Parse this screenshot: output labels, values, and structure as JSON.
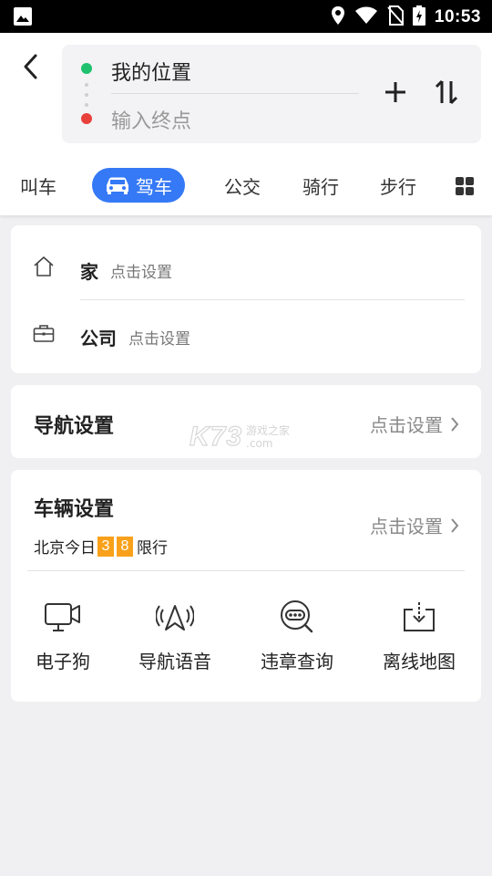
{
  "status_bar": {
    "time": "10:53",
    "icons": [
      "image-icon",
      "location-icon",
      "wifi-icon",
      "no-sim-icon",
      "battery-charging-icon"
    ]
  },
  "route": {
    "back_icon": "back-arrow-icon",
    "from": "我的位置",
    "to_placeholder": "输入终点",
    "add_icon": "plus-icon",
    "swap_icon": "swap-vertical-icon",
    "start_color": "#1fc16e",
    "end_color": "#e8403a"
  },
  "tabs": {
    "items": [
      {
        "label": "叫车"
      },
      {
        "label": "驾车",
        "active": true,
        "icon": "car-icon"
      },
      {
        "label": "公交"
      },
      {
        "label": "骑行"
      },
      {
        "label": "步行"
      }
    ],
    "more_icon": "grid-icon",
    "active_color": "#3579f6"
  },
  "places": {
    "home": {
      "name": "家",
      "hint": "点击设置",
      "icon": "home-icon"
    },
    "company": {
      "name": "公司",
      "hint": "点击设置",
      "icon": "briefcase-icon"
    }
  },
  "nav_settings": {
    "title": "导航设置",
    "action": "点击设置"
  },
  "watermark": {
    "logo": "K73",
    "line1": "游戏之家",
    "line2": ".com"
  },
  "vehicle_settings": {
    "title": "车辆设置",
    "action": "点击设置",
    "restriction": {
      "prefix": "北京今日",
      "plates": [
        "3",
        "8"
      ],
      "suffix": "限行"
    },
    "plate_color": "#f9a11b",
    "tools": [
      {
        "label": "电子狗",
        "icon": "camera-icon"
      },
      {
        "label": "导航语音",
        "icon": "nav-voice-icon"
      },
      {
        "label": "违章查询",
        "icon": "violation-search-icon"
      },
      {
        "label": "离线地图",
        "icon": "offline-download-icon"
      }
    ]
  }
}
